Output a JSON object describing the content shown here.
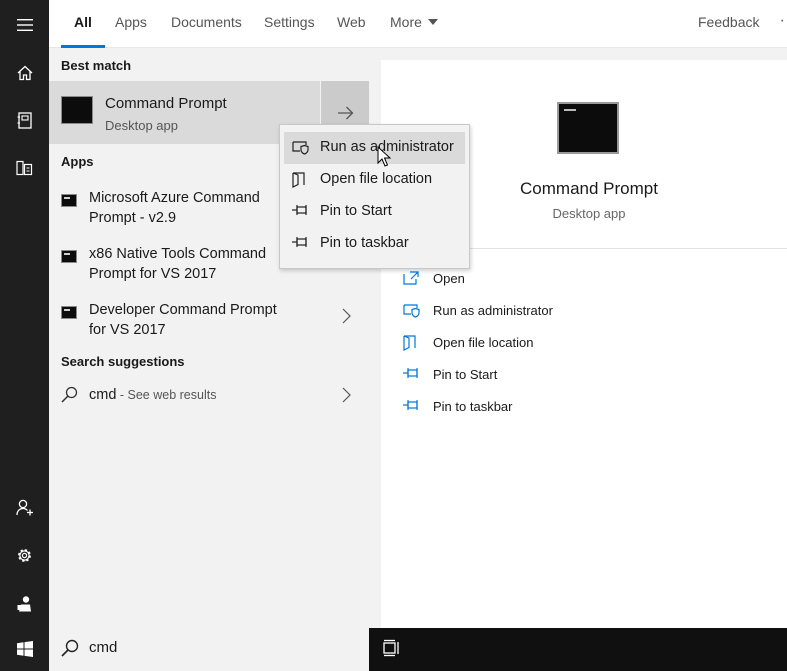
{
  "tabs": [
    {
      "label": "All",
      "active": true
    },
    {
      "label": "Apps"
    },
    {
      "label": "Documents"
    },
    {
      "label": "Settings"
    },
    {
      "label": "Web"
    },
    {
      "label": "More"
    }
  ],
  "header": {
    "feedback_label": "Feedback",
    "more_glyph": "·"
  },
  "results": {
    "best_match_heading": "Best match",
    "best_match": {
      "title": "Command Prompt",
      "subtitle": "Desktop app",
      "icon": "terminal-icon"
    },
    "apps_heading": "Apps",
    "apps": [
      {
        "label": "Microsoft Azure Command Prompt - v2.9"
      },
      {
        "label": "x86 Native Tools Command Prompt for VS 2017"
      },
      {
        "label": "Developer Command Prompt for VS 2017",
        "has_chevron": true
      }
    ],
    "suggestions_heading": "Search suggestions",
    "suggestion": {
      "query": "cmd",
      "hint": " - See web results"
    }
  },
  "context_menu": {
    "items": [
      {
        "label": "Run as administrator",
        "icon": "shield-icon",
        "hover": true
      },
      {
        "label": "Open file location",
        "icon": "folder-icon"
      },
      {
        "label": "Pin to Start",
        "icon": "pin-icon"
      },
      {
        "label": "Pin to taskbar",
        "icon": "pin-icon"
      }
    ]
  },
  "preview": {
    "title": "Command Prompt",
    "subtitle": "Desktop app",
    "actions": [
      {
        "label": "Open",
        "icon": "open-icon"
      },
      {
        "label": "Run as administrator",
        "icon": "shield-icon"
      },
      {
        "label": "Open file location",
        "icon": "folder-icon"
      },
      {
        "label": "Pin to Start",
        "icon": "pin-icon"
      },
      {
        "label": "Pin to taskbar",
        "icon": "pin-icon"
      }
    ]
  },
  "search": {
    "value": "cmd"
  },
  "sidebar": {
    "items": [
      "menu-icon",
      "home-icon",
      "notebook-icon",
      "documents-icon",
      "user-add-icon",
      "gear-icon",
      "user-icon",
      "windows-icon"
    ]
  },
  "colors": {
    "accent": "#0078d7",
    "rail": "#1f1f1f",
    "panel": "#f2f2f2",
    "selected": "#dadada",
    "taskbar": "#101010"
  }
}
